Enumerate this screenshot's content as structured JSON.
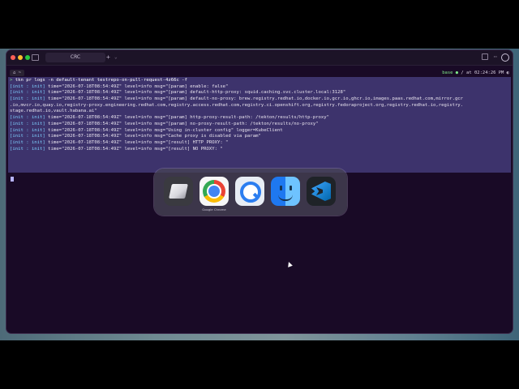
{
  "window": {
    "tab_title": "CRC",
    "new_tab_symbol": "+",
    "tab_menu_symbol": "⌄"
  },
  "prompt": {
    "left": "  ⌂ ~",
    "env": "base ●",
    "time": "/ at 02:24:26 PM ◐"
  },
  "terminal": {
    "command_arrow": ">",
    "command": "tkn pr logs -n default-tenant testrepo-on-pull-request-4z66c -f",
    "lines": [
      {
        "tag": "[init : init]",
        "text": " time=\"2026-07-18T08:54:49Z\" level=info msg=\"[param] enable: false\""
      },
      {
        "tag": "[init : init]",
        "text": " time=\"2026-07-18T08:54:49Z\" level=info msg=\"[param] default-http-proxy: squid.caching.svc.cluster.local:3128\""
      },
      {
        "tag": "[init : init]",
        "text": " time=\"2026-07-18T08:54:49Z\" level=info msg=\"[param] default-no-proxy: brew.registry.redhat.io,docker.io,gcr.io,ghcr.io,images.paas.redhat.com,mirror.gcr"
      },
      {
        "tag": "",
        "text": ".io,mvcr.io,quay.io,registry-proxy.engineering.redhat.com,registry.access.redhat.com,registry.ci.openshift.org,registry.fedoraproject.org,registry.redhat.io,registry."
      },
      {
        "tag": "",
        "text": "stage.redhat.io,vault.habana.ai\""
      },
      {
        "tag": "[init : init]",
        "text": " time=\"2026-07-18T08:54:49Z\" level=info msg=\"[param] http-proxy-result-path: /tekton/results/http-proxy\""
      },
      {
        "tag": "[init : init]",
        "text": " time=\"2026-07-18T08:54:49Z\" level=info msg=\"[param] no-proxy-result-path: /tekton/results/no-proxy\""
      },
      {
        "tag": "[init : init]",
        "text": " time=\"2026-07-18T08:54:49Z\" level=info msg=\"Using in-cluster config\" logger=KubeClient"
      },
      {
        "tag": "[init : init]",
        "text": " time=\"2026-07-18T08:54:49Z\" level=info msg=\"Cache proxy is disabled via param\""
      },
      {
        "tag": "[init : init]",
        "text": " time=\"2026-07-18T08:54:49Z\" level=info msg=\"[result] HTTP PROXY: \""
      },
      {
        "tag": "[init : init]",
        "text": " time=\"2026-07-18T08:54:49Z\" level=info msg=\"[result] NO PROXY: \""
      }
    ]
  },
  "dock": {
    "chrome_label": "Google Chrome"
  }
}
